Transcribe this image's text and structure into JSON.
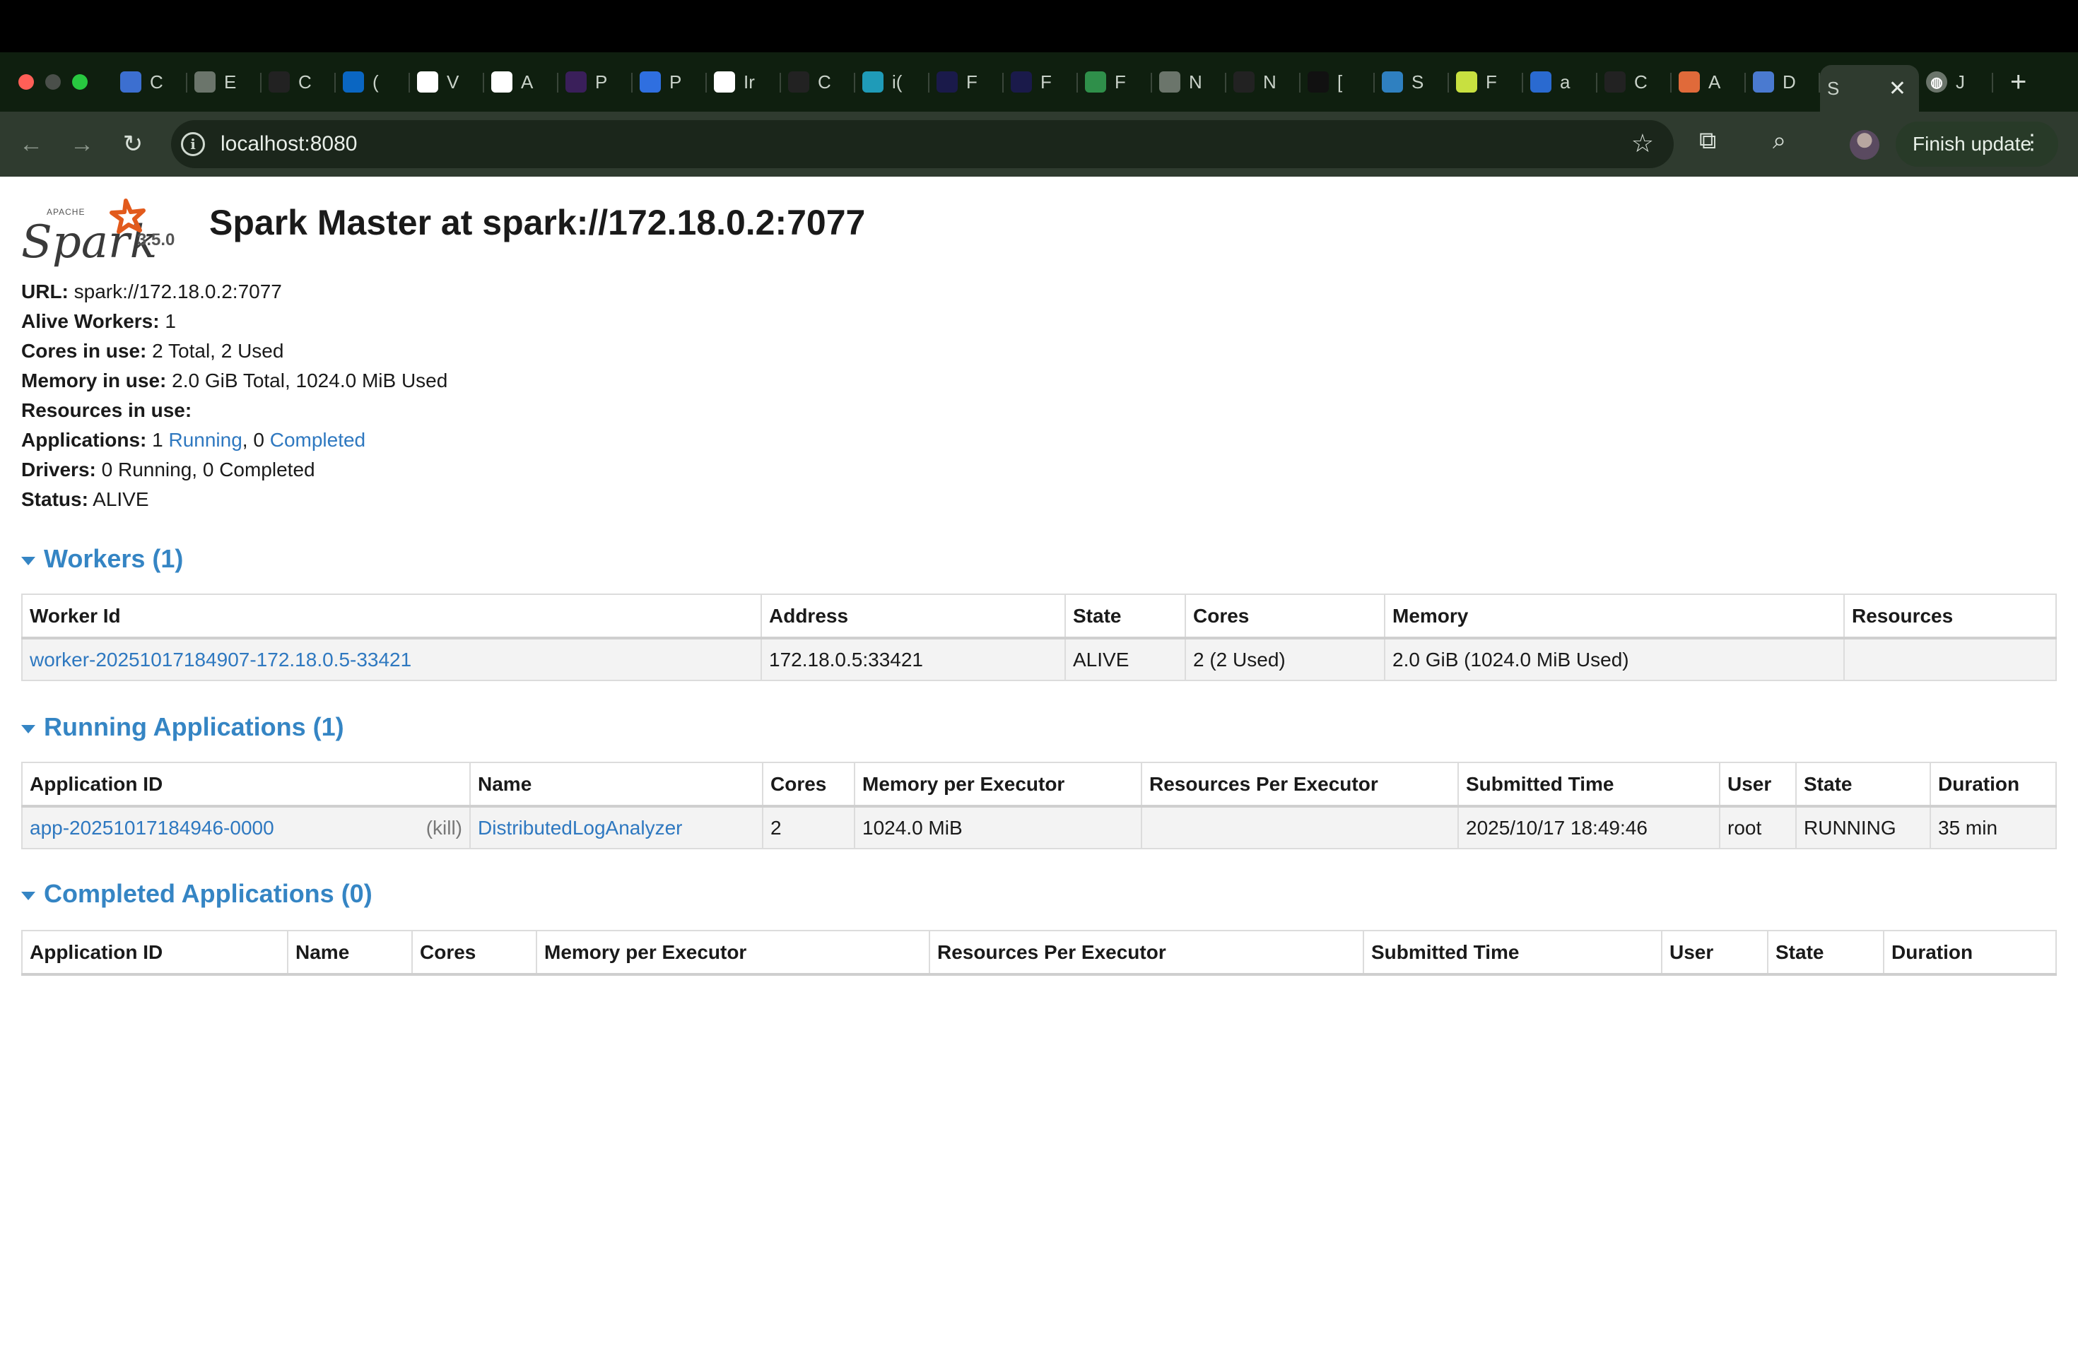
{
  "browser": {
    "tabs": [
      {
        "icon": "bitwarden-icon",
        "label": "C",
        "color": "#3c6fd0"
      },
      {
        "icon": "globe-icon",
        "label": "E",
        "color": "#6b756b"
      },
      {
        "icon": "github-icon",
        "label": "C",
        "color": "#222222"
      },
      {
        "icon": "linkedin-icon",
        "label": "(",
        "color": "#0a66c2"
      },
      {
        "icon": "google-icon",
        "label": "V",
        "color": "#ffffff"
      },
      {
        "icon": "google-icon",
        "label": "A",
        "color": "#ffffff"
      },
      {
        "icon": "purple-dot-icon",
        "label": "P",
        "color": "#3a1f5a"
      },
      {
        "icon": "play-icon",
        "label": "P",
        "color": "#2f6fe0"
      },
      {
        "icon": "gmail-icon",
        "label": "Ir",
        "color": "#ffffff"
      },
      {
        "icon": "github-icon",
        "label": "C",
        "color": "#222222"
      },
      {
        "icon": "media-icon",
        "label": "i(",
        "color": "#1f9bb8"
      },
      {
        "icon": "r-icon",
        "label": "F",
        "color": "#1a1a4a"
      },
      {
        "icon": "r-icon",
        "label": "F",
        "color": "#1a1a4a"
      },
      {
        "icon": "bolt-icon",
        "label": "F",
        "color": "#2f8f4a"
      },
      {
        "icon": "chrome-icon",
        "label": "N",
        "color": "#6b756b"
      },
      {
        "icon": "github-icon",
        "label": "N",
        "color": "#222222"
      },
      {
        "icon": "github-dark-icon",
        "label": "[",
        "color": "#111111"
      },
      {
        "icon": "stack-icon",
        "label": "S",
        "color": "#2f80c0"
      },
      {
        "icon": "pen-icon",
        "label": "F",
        "color": "#c8e040"
      },
      {
        "icon": "docker-icon",
        "label": "a",
        "color": "#2a6ad0"
      },
      {
        "icon": "github-icon",
        "label": "C",
        "color": "#222222"
      },
      {
        "icon": "star-icon",
        "label": "A",
        "color": "#e06a3a"
      },
      {
        "icon": "chart-icon",
        "label": "D",
        "color": "#4a7ad0"
      }
    ],
    "active_tab": {
      "label": "S"
    },
    "after_tab": {
      "icon": "globe-icon",
      "label": "J"
    },
    "url": "localhost:8080",
    "finish_update": "Finish update"
  },
  "spark": {
    "version": "3.5.0",
    "title": "Spark Master at spark://172.18.0.2:7077",
    "summary": {
      "url_label": "URL:",
      "url_value": " spark://172.18.0.2:7077",
      "alive_label": "Alive Workers:",
      "alive_value": " 1",
      "cores_label": "Cores in use:",
      "cores_value": " 2 Total, 2 Used",
      "memory_label": "Memory in use:",
      "memory_value": " 2.0 GiB Total, 1024.0 MiB Used",
      "resources_label": "Resources in use:",
      "apps_label": "Applications:",
      "apps_prefix": " 1 ",
      "apps_running": "Running",
      "apps_middle": ", 0 ",
      "apps_completed": "Completed",
      "drivers_label": "Drivers:",
      "drivers_value": " 0 Running, 0 Completed",
      "status_label": "Status:",
      "status_value": " ALIVE"
    },
    "workers": {
      "heading": "Workers (1)",
      "columns": [
        "Worker Id",
        "Address",
        "State",
        "Cores",
        "Memory",
        "Resources"
      ],
      "rows": [
        {
          "id": "worker-20251017184907-172.18.0.5-33421",
          "address": "172.18.0.5:33421",
          "state": "ALIVE",
          "cores": "2 (2 Used)",
          "memory": "2.0 GiB (1024.0 MiB Used)",
          "resources": ""
        }
      ]
    },
    "running": {
      "heading": "Running Applications (1)",
      "columns": [
        "Application ID",
        "Name",
        "Cores",
        "Memory per Executor",
        "Resources Per Executor",
        "Submitted Time",
        "User",
        "State",
        "Duration"
      ],
      "rows": [
        {
          "id": "app-20251017184946-0000",
          "kill": "(kill)",
          "name": "DistributedLogAnalyzer",
          "cores": "2",
          "memory": "1024.0 MiB",
          "resources": "",
          "submitted": "2025/10/17 18:49:46",
          "user": "root",
          "state": "RUNNING",
          "duration": "35 min"
        }
      ]
    },
    "completed": {
      "heading": "Completed Applications (0)",
      "columns": [
        "Application ID",
        "Name",
        "Cores",
        "Memory per Executor",
        "Resources Per Executor",
        "Submitted Time",
        "User",
        "State",
        "Duration"
      ]
    }
  }
}
